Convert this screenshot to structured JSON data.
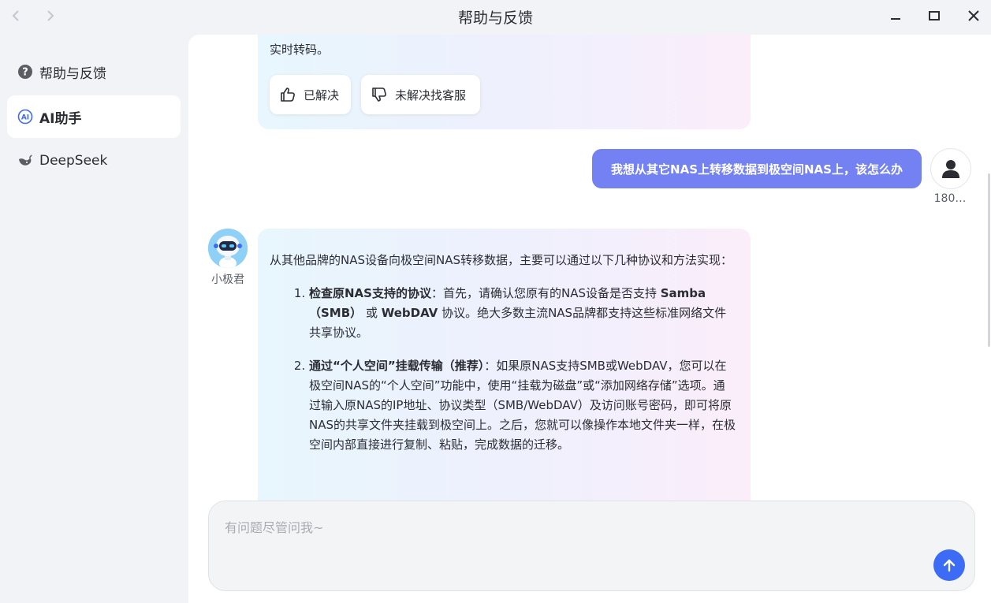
{
  "window": {
    "title": "帮助与反馈"
  },
  "sidebar": {
    "items": [
      {
        "label": "帮助与反馈",
        "icon": "help-icon"
      },
      {
        "label": "AI助手",
        "icon": "ai-icon",
        "active": true
      },
      {
        "label": "DeepSeek",
        "icon": "deepseek-icon"
      }
    ]
  },
  "chat": {
    "prev_answer_tail": "实时转码。",
    "feedback": {
      "resolved_label": "已解决",
      "unresolved_label": "未解决找客服"
    },
    "user_message": "我想从其它NAS上转移数据到极空间NAS上，该怎么办",
    "user_name": "180…",
    "bot_name": "小极君",
    "bot_answer": {
      "intro": "从其他品牌的NAS设备向极空间NAS转移数据，主要可以通过以下几种协议和方法实现：",
      "items": [
        {
          "title": "检查原NAS支持的协议",
          "t1": "：首先，请确认您原有的NAS设备是否支持 ",
          "b1": "Samba（SMB）",
          "t2": " 或 ",
          "b2": "WebDAV",
          "t3": " 协议。绝大多数主流NAS品牌都支持这些标准网络文件共享协议。"
        },
        {
          "title": "通过“个人空间”挂载传输（推荐）",
          "text": "：如果原NAS支持SMB或WebDAV，您可以在极空间NAS的“个人空间”功能中，使用“挂载为磁盘”或“添加网络存储”选项。通过输入原NAS的IP地址、协议类型（SMB/WebDAV）及访问账号密码，即可将原NAS的共享文件夹挂载到极空间上。之后，您就可以像操作本地文件夹一样，在极空间内部直接进行复制、粘贴，完成数据的迁移。"
        }
      ]
    }
  },
  "input": {
    "placeholder": "有问题尽管问我~"
  },
  "colors": {
    "user_bubble": "#7381f2",
    "send_button": "#3c6bf5"
  }
}
